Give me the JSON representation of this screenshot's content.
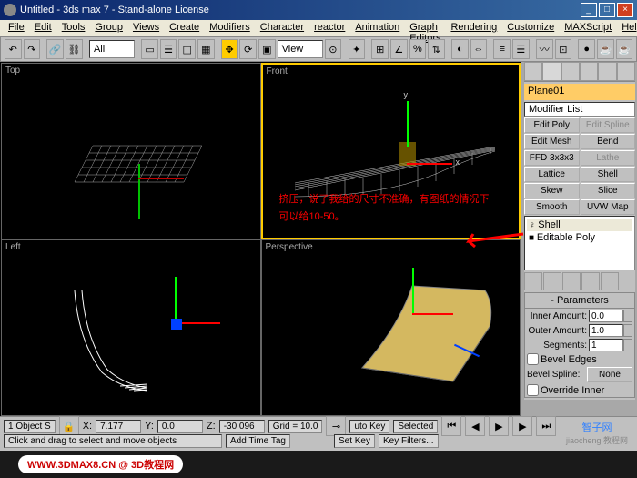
{
  "window": {
    "title": "Untitled - 3ds max 7 - Stand-alone License"
  },
  "menus": [
    "File",
    "Edit",
    "Tools",
    "Group",
    "Views",
    "Create",
    "Modifiers",
    "Character",
    "reactor",
    "Animation",
    "Graph Editors",
    "Rendering",
    "Customize",
    "MAXScript",
    "Help"
  ],
  "toolbar": {
    "selection_filter": "All",
    "view_mode": "View"
  },
  "viewports": {
    "top": "Top",
    "front": "Front",
    "left": "Left",
    "perspective": "Perspective"
  },
  "annotations": {
    "line1": "挤压，说了我给的尺寸不准确，有图纸的情况下",
    "line2": "可以给10-50。"
  },
  "command_panel": {
    "object_name": "Plane01",
    "modifier_list_label": "Modifier List",
    "buttons": [
      [
        "Edit Poly",
        "Edit Spline"
      ],
      [
        "Edit Mesh",
        "Bend"
      ],
      [
        "FFD 3x3x3",
        "Lathe"
      ],
      [
        "Lattice",
        "Shell"
      ],
      [
        "Skew",
        "Slice"
      ],
      [
        "Smooth",
        "UVW Map"
      ]
    ],
    "stack": [
      "Shell",
      "Editable Poly"
    ],
    "rollout_title": "Parameters",
    "params": {
      "inner_amount_label": "Inner Amount:",
      "inner_amount": "0.0",
      "outer_amount_label": "Outer Amount:",
      "outer_amount": "1.0",
      "segments_label": "Segments:",
      "segments": "1",
      "bevel_edges_label": "Bevel Edges",
      "bevel_spline_label": "Bevel Spline:",
      "bevel_spline_btn": "None",
      "override_inner_label": "Override Inner"
    }
  },
  "status": {
    "selection": "1 Object S",
    "x_label": "X:",
    "x": "7.177",
    "y_label": "Y:",
    "y": "0.0",
    "z_label": "Z:",
    "z": "-30.096",
    "grid": "Grid = 10.0",
    "hint": "Click and drag to select and move objects",
    "add_time": "Add Time Tag",
    "autokey": "uto Key",
    "selected": "Selected",
    "setkey": "Set Key",
    "keyfilters": "Key Filters..."
  },
  "watermark": {
    "url": "WWW.3DMAX8.CN @ 3D教程网",
    "brand1": "智子网",
    "brand2": "jiaocheng 教程网"
  }
}
